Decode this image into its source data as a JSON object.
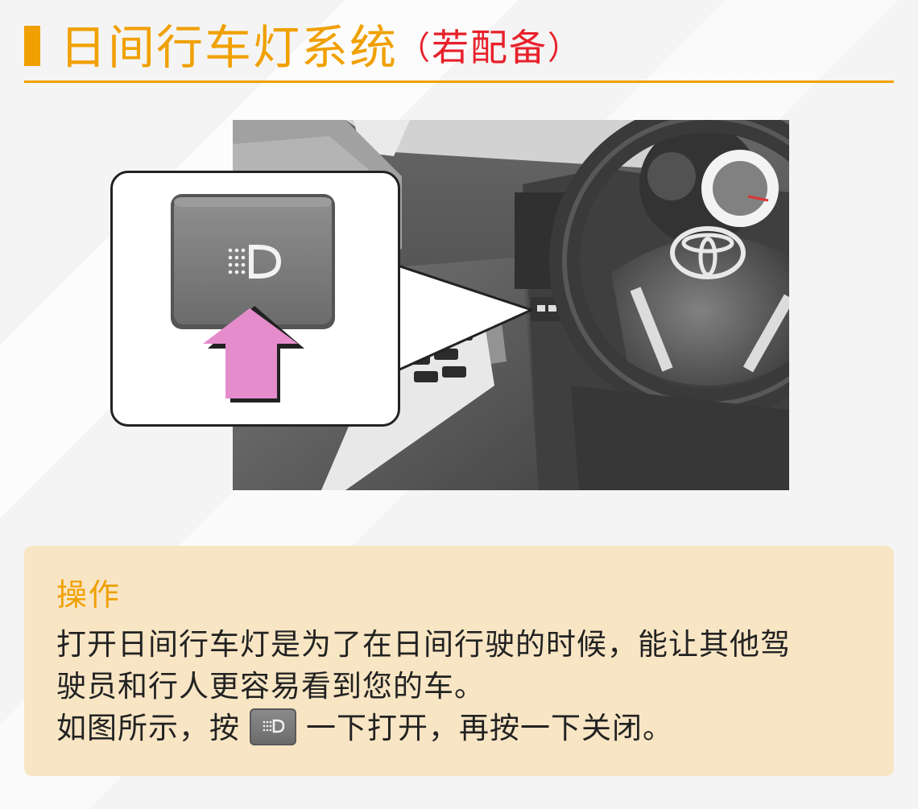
{
  "header": {
    "title": "日间行车灯系统",
    "paren_open": "（",
    "optional": "若配备",
    "paren_close": "）"
  },
  "illustration": {
    "brand_logo_icon": "toyota-logo-icon",
    "switch_icon": "daytime-running-light-icon",
    "arrow_color": "#e58ccc"
  },
  "info": {
    "heading": "操作",
    "line1": "打开日间行车灯是为了在日间行驶的时候，能让其他驾",
    "line2": "驶员和行人更容易看到您的车。",
    "line3_before": "如图所示，按",
    "line3_after": "一下打开，再按一下关闭。"
  },
  "colors": {
    "accent": "#f0a000",
    "optional_red": "#e8202a",
    "info_bg": "#f8e5c4"
  }
}
